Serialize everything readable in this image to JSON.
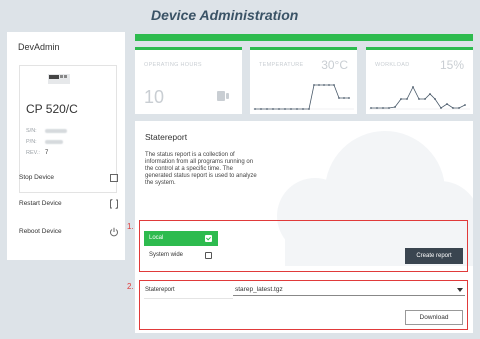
{
  "header": {
    "title": "Device Administration"
  },
  "left_panel": {
    "title": "DevAdmin",
    "device": {
      "model": "CP 520/C",
      "sn_label": "S/N:",
      "pin_label": "P/N:",
      "rev_label": "REV.:",
      "rev_value": "7"
    },
    "actions": [
      {
        "label": "Stop Device",
        "icon": "stop-icon"
      },
      {
        "label": "Restart Device",
        "icon": "restart-icon"
      },
      {
        "label": "Reboot Device",
        "icon": "power-icon"
      }
    ]
  },
  "metrics": [
    {
      "label": "OPERATING HOURS",
      "value": "10",
      "icon": "hourglass-icon"
    },
    {
      "label": "TEMPERATURE",
      "value": "30°C"
    },
    {
      "label": "WORKLOAD",
      "value": "15%"
    }
  ],
  "statereport": {
    "title": "Statereport",
    "description": "The status report is a collection of information from all programs running on the control at a specific time. The generated status report is used to analyze the system.",
    "annotation_1": "1.",
    "annotation_2": "2.",
    "options": [
      {
        "label": "Local",
        "selected": true
      },
      {
        "label": "System wide",
        "selected": false
      }
    ],
    "create_button": "Create report",
    "select_label": "Statereport",
    "select_value": "starep_latest.tgz",
    "download_button": "Download"
  },
  "colors": {
    "accent": "#2dbb4e",
    "annotation": "#e03a3a",
    "title": "#3a5366",
    "dark_button": "#3a4550"
  }
}
